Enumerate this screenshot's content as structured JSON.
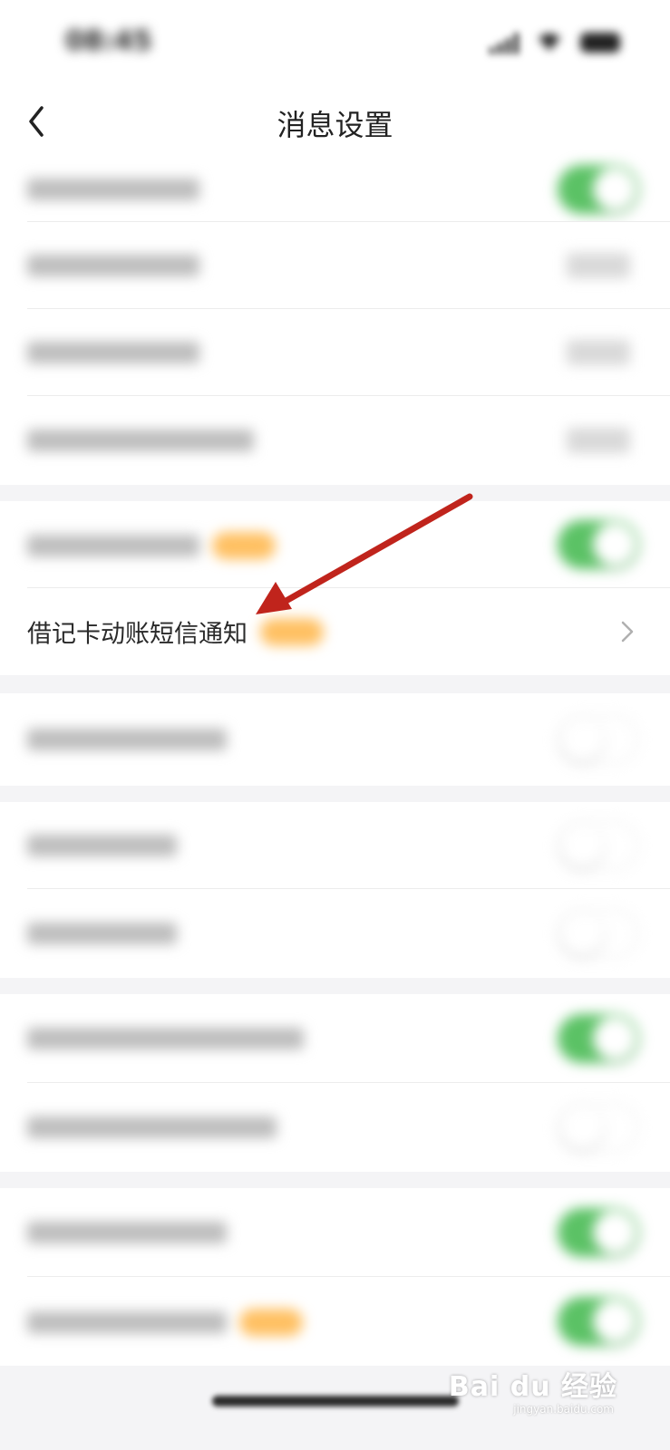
{
  "status_bar": {
    "time": "08:45"
  },
  "header": {
    "title": "消息设置",
    "back_icon": "chevron-left-icon"
  },
  "settings": {
    "highlighted_item": {
      "label": "借记卡动账短信通知"
    }
  },
  "colors": {
    "toggle_on": "#5bc265",
    "badge": "#ffc062",
    "arrow": "#c0241c"
  },
  "watermark": {
    "brand": "Bai du 经验",
    "url": "jingyan.baidu.com"
  }
}
